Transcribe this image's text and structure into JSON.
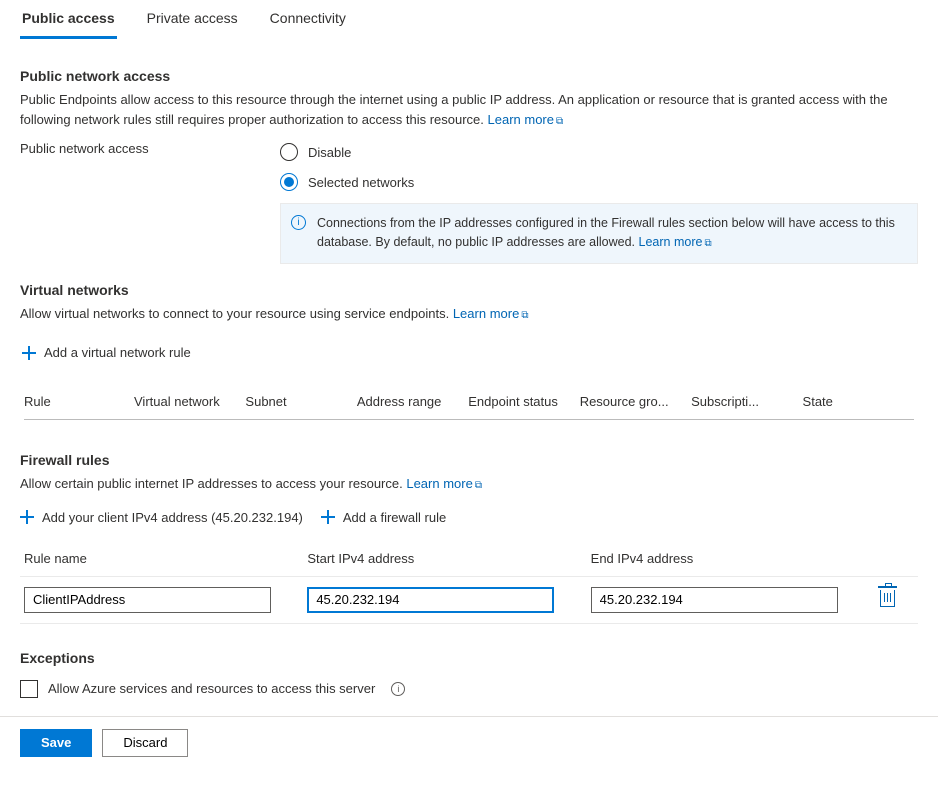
{
  "tabs": {
    "public": "Public access",
    "private": "Private access",
    "connectivity": "Connectivity"
  },
  "pna": {
    "heading": "Public network access",
    "desc": "Public Endpoints allow access to this resource through the internet using a public IP address. An application or resource that is granted access with the following network rules still requires proper authorization to access this resource. ",
    "learn": "Learn more",
    "label": "Public network access",
    "radio_disable": "Disable",
    "radio_selected": "Selected networks",
    "info": "Connections from the IP addresses configured in the Firewall rules section below will have access to this database. By default, no public IP addresses are allowed.  ",
    "info_learn": "Learn more"
  },
  "vn": {
    "heading": "Virtual networks",
    "desc": "Allow virtual networks to connect to your resource using service endpoints. ",
    "learn": "Learn more",
    "add": "Add a virtual network rule",
    "cols": {
      "rule": "Rule",
      "vnet": "Virtual network",
      "subnet": "Subnet",
      "addr": "Address range",
      "endpoint": "Endpoint status",
      "rg": "Resource gro...",
      "sub": "Subscripti...",
      "state": "State"
    }
  },
  "fw": {
    "heading": "Firewall rules",
    "desc": "Allow certain public internet IP addresses to access your resource. ",
    "learn": "Learn more",
    "add_client": "Add your client IPv4 address (45.20.232.194)",
    "add_rule": "Add a firewall rule",
    "cols": {
      "name": "Rule name",
      "start": "Start IPv4 address",
      "end": "End IPv4 address"
    },
    "row": {
      "name": "ClientIPAddress",
      "start": "45.20.232.194",
      "end": "45.20.232.194"
    }
  },
  "ex": {
    "heading": "Exceptions",
    "allow_azure": "Allow Azure services and resources to access this server"
  },
  "footer": {
    "save": "Save",
    "discard": "Discard"
  }
}
